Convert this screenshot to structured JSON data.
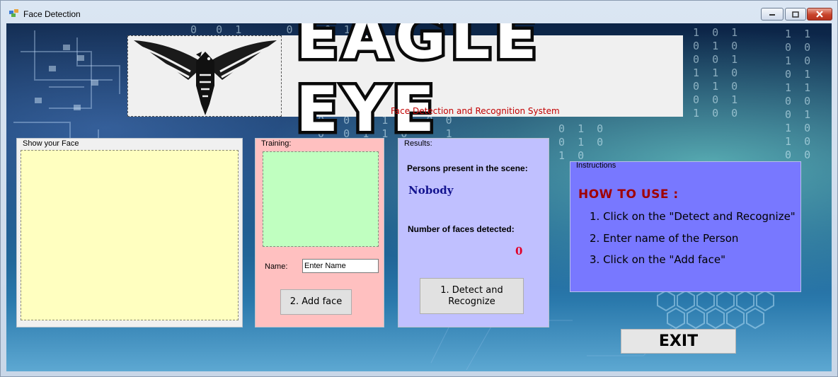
{
  "window": {
    "title": "Face Detection",
    "controls": {
      "minimize": "minimize-icon",
      "maximize": "maximize-icon",
      "close": "close-icon"
    }
  },
  "header": {
    "title": "EAGLE EYE",
    "subtitle": "Face Detection and Recognition System",
    "logo_icon": "eagle-icon"
  },
  "face_panel": {
    "label": "Show your Face"
  },
  "training": {
    "label": "Training:",
    "name_label": "Name:",
    "name_value": "Enter Name",
    "add_button": "2. Add face"
  },
  "results": {
    "label": "Results:",
    "persons_label": "Persons present in the scene:",
    "persons_value": "Nobody",
    "faces_label": "Number of faces detected:",
    "faces_value": "0",
    "detect_button_line1": "1. Detect and",
    "detect_button_line2": "Recognize"
  },
  "instructions": {
    "label": "Instructions",
    "heading": "HOW TO USE :",
    "steps": [
      "1. Click on the \"Detect and Recognize\"",
      "2. Enter name of the Person",
      "3. Click on the \"Add face\""
    ]
  },
  "exit_button": "EXIT",
  "colors": {
    "face_box": "#ffffc0",
    "training_panel": "#ffc0c0",
    "training_box": "#c0ffc0",
    "results_panel": "#c0c0ff",
    "instructions_panel": "#7878ff",
    "subtitle": "#c20000",
    "persons_value": "#13138f",
    "faces_value": "#e0002a",
    "instr_heading": "#a00000"
  }
}
